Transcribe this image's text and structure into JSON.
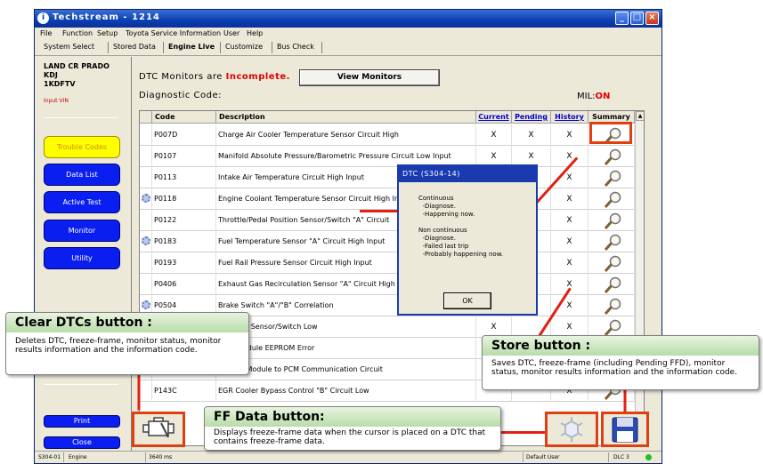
{
  "window": {
    "title": "Techstream - 1214",
    "controls": [
      "_",
      "□",
      "×"
    ]
  },
  "menu": [
    "File",
    "Function",
    "Setup",
    "Toyota Service Information",
    "User",
    "Help"
  ],
  "tabs": [
    "System Select",
    "Stored Data",
    "Engine Live",
    "Customize",
    "Bus Check"
  ],
  "vehicle": {
    "line1": "LAND CR PRADO",
    "line2": "KDJ",
    "line3": "1KDFTV",
    "input_vin": "Input VIN"
  },
  "nav": {
    "trouble_codes": "Trouble Codes",
    "data_list": "Data List",
    "active_test": "Active Test",
    "monitor": "Monitor",
    "utility": "Utility",
    "print": "Print",
    "close": "Close"
  },
  "main": {
    "dtc_monitors_prefix": "DTC Monitors are",
    "dtc_monitors_status": "Incomplete.",
    "view_monitors": "View Monitors",
    "diagnostic_code": "Diagnostic Code:",
    "mil_label": "MIL:",
    "mil_value": "ON"
  },
  "table": {
    "headers": {
      "code": "Code",
      "description": "Description",
      "current": "Current",
      "pending": "Pending",
      "history": "History",
      "summary": "Summary"
    },
    "rows": [
      {
        "code": "P007D",
        "desc": "Charge Air Cooler Temperature Sensor Circuit High",
        "current": "X",
        "pending": "X",
        "history": "X",
        "ff": false
      },
      {
        "code": "P0107",
        "desc": "Manifold Absolute Pressure/Barometric Pressure Circuit Low Input",
        "current": "X",
        "pending": "X",
        "history": "X",
        "ff": false
      },
      {
        "code": "P0113",
        "desc": "Intake Air Temperature Circuit High Input",
        "current": "",
        "pending": "",
        "history": "X",
        "ff": false
      },
      {
        "code": "P0118",
        "desc": "Engine Coolant Temperature Sensor Circuit High Input",
        "current": "",
        "pending": "",
        "history": "X",
        "ff": true
      },
      {
        "code": "P0122",
        "desc": "Throttle/Pedal Position Sensor/Switch \"A\" Circuit",
        "current": "",
        "pending": "",
        "history": "X",
        "ff": false
      },
      {
        "code": "P0183",
        "desc": "Fuel Temperature Sensor \"A\" Circuit High Input",
        "current": "",
        "pending": "",
        "history": "X",
        "ff": true
      },
      {
        "code": "P0193",
        "desc": "Fuel Rail Pressure Sensor Circuit High Input",
        "current": "",
        "pending": "",
        "history": "X",
        "ff": false
      },
      {
        "code": "P0406",
        "desc": "Exhaust Gas Recirculation Sensor \"A\" Circuit High",
        "current": "",
        "pending": "",
        "history": "X",
        "ff": false
      },
      {
        "code": "P0504",
        "desc": "Brake Switch \"A\"/\"B\" Correlation",
        "current": "",
        "pending": "",
        "history": "X",
        "ff": true
      },
      {
        "code": "",
        "desc": "Pressure Sensor/Switch Low",
        "current": "X",
        "pending": "",
        "history": "X",
        "ff": false
      },
      {
        "code": "",
        "desc": "ntrol Module EEPROM Error",
        "current": "",
        "pending": "",
        "history": "X",
        "ff": false
      },
      {
        "code": "",
        "desc": "Control Module to PCM Communication Circuit",
        "current": "",
        "pending": "",
        "history": "X",
        "ff": false
      },
      {
        "code": "P143C",
        "desc": "EGR Cooler Bypass Control \"B\" Circuit Low",
        "current": "",
        "pending": "",
        "history": "X",
        "ff": false
      }
    ]
  },
  "dialog": {
    "title": "DTC (S304-14)",
    "body": "Continuous\n  -Diagnose.\n  -Happening now.\n\nNon continuous\n  -Diagnose.\n  -Failed last trip\n  -Probably happening now.",
    "ok": "OK"
  },
  "status": {
    "code": "S304-01",
    "system": "Engine",
    "time": "3640 ms",
    "user": "Default User",
    "dlc": "DLC 3"
  },
  "callouts": {
    "clear": {
      "title": "Clear DTCs button :",
      "text": "Deletes DTC, freeze-frame, monitor status, monitor results information and the information code."
    },
    "store": {
      "title": "Store button :",
      "text": "Saves DTC, freeze-frame (including Pending FFD), monitor status, monitor results information and the information code."
    },
    "ff": {
      "title": "FF Data button:",
      "text": "Displays freeze-frame data when the cursor is placed on a DTC that contains freeze-frame data."
    }
  },
  "colors": {
    "accent_red": "#e04010",
    "nav_blue": "#0a1ef0",
    "active_yellow": "#ffff00"
  }
}
